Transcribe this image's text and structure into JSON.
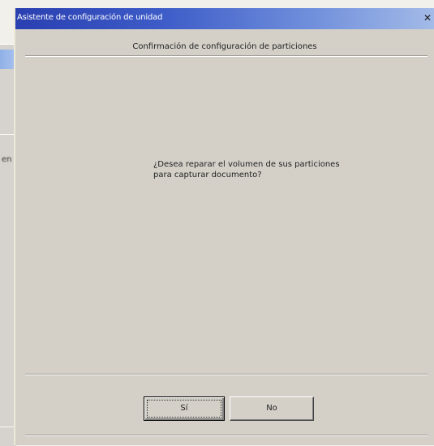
{
  "dialog": {
    "title": "Asistente de configuración de unidad",
    "header": "Confirmación de configuración de particiones",
    "message_line1": "¿Desea reparar el volumen de sus particiones",
    "message_line2": "para capturar documento?",
    "yes_label": "Sí",
    "no_label": "No",
    "close_icon": "close-icon"
  },
  "background_window": {
    "partial_text": "en"
  },
  "colors": {
    "titlebar_start": "#2a3fb0",
    "titlebar_end": "#a3bbe8",
    "dialog_face": "#d4d0c8"
  }
}
